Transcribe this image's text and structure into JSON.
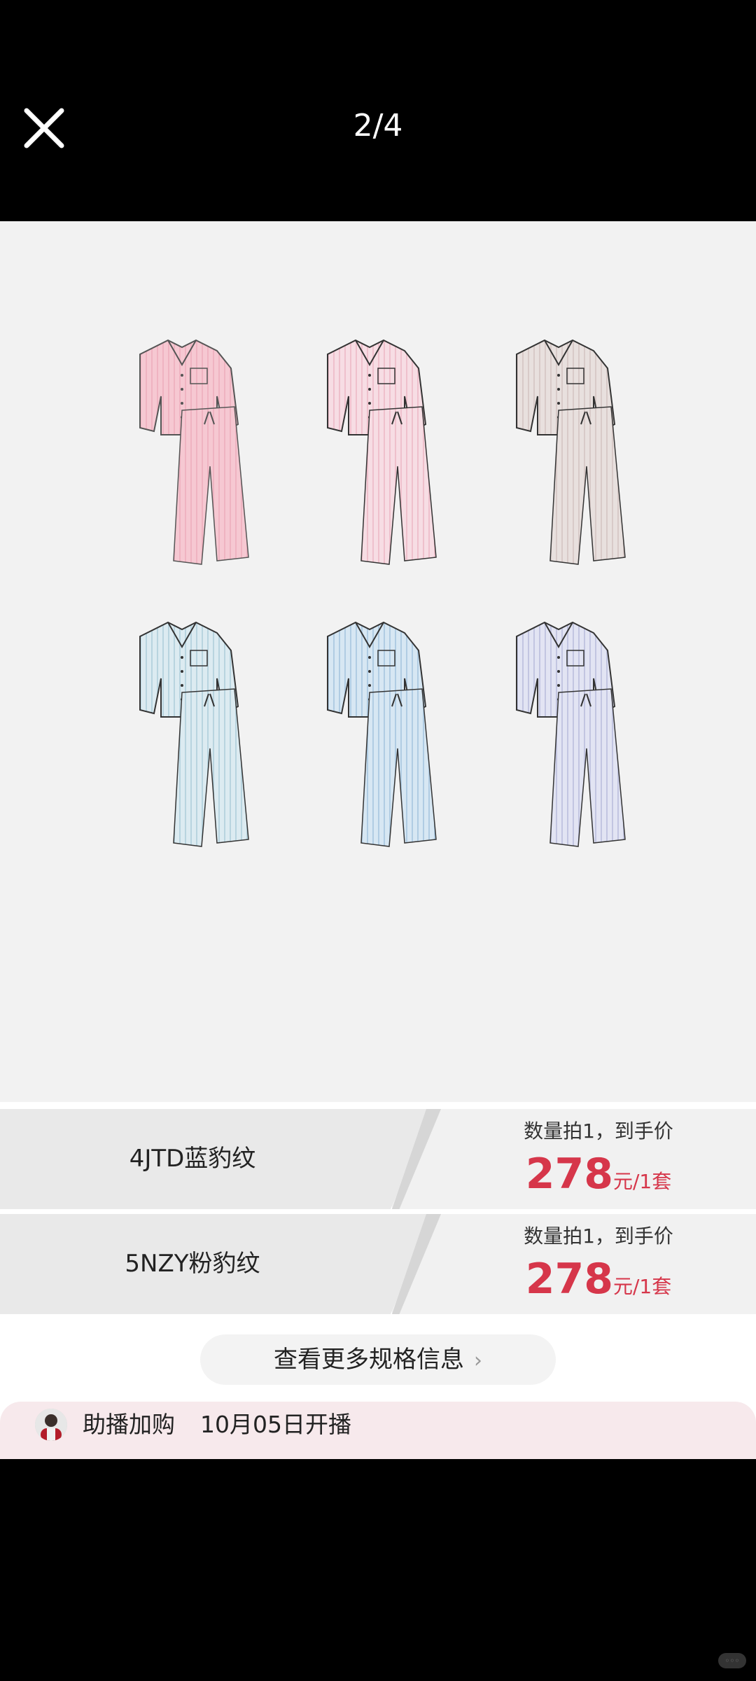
{
  "viewer": {
    "counter": "2/4"
  },
  "products": [
    {
      "name": "pink-leopard-pajama",
      "shirt": "#f6c8d2",
      "pants": "#f3c0cb",
      "pattern": "#e9a1b2",
      "trim": "#555"
    },
    {
      "name": "pink-stripe-pajama",
      "shirt": "#f7dde4",
      "pants": "#f6dbe3",
      "pattern": "#e9a7b7",
      "trim": "#333"
    },
    {
      "name": "beige-print-pajama",
      "shirt": "#e8e0de",
      "pants": "#e9e1df",
      "pattern": "#c9b7b5",
      "trim": "#333"
    },
    {
      "name": "blue-leopard-pajama",
      "shirt": "#dcebf1",
      "pants": "#dcebf1",
      "pattern": "#9bc0cf",
      "trim": "#333"
    },
    {
      "name": "blue-stripe-pajama",
      "shirt": "#d7e7f3",
      "pants": "#d7e7f3",
      "pattern": "#8fb6d5",
      "trim": "#333"
    },
    {
      "name": "lavender-print-pajama",
      "shirt": "#e2e4f3",
      "pants": "#e0e2f2",
      "pattern": "#a7aad1",
      "trim": "#333"
    }
  ],
  "specs": [
    {
      "name": "4JTD蓝豹纹",
      "caption": "数量拍1，到手价",
      "price": "278",
      "unit": "元/1套"
    },
    {
      "name": "5NZY粉豹纹",
      "caption": "数量拍1，到手价",
      "price": "278",
      "unit": "元/1套"
    }
  ],
  "more_button": {
    "label": "查看更多规格信息"
  },
  "live": {
    "label": "助播加购",
    "time": "10月05日开播"
  },
  "colors": {
    "accent": "#d6364a",
    "live_bg": "#f7e9ec"
  }
}
